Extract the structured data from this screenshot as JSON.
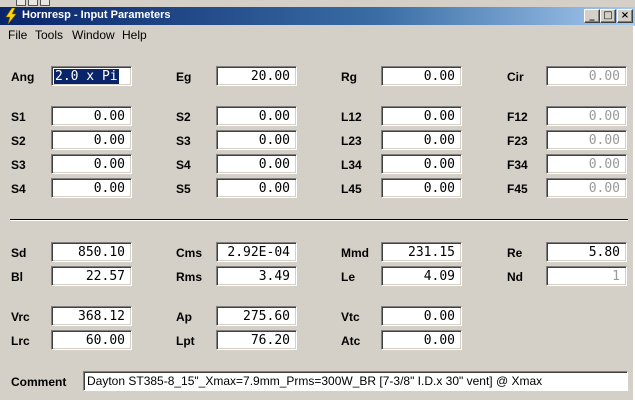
{
  "window": {
    "title": "Hornresp - Input Parameters",
    "controls": {
      "minimize": "_",
      "maximize": "□",
      "close": "×"
    }
  },
  "menu": [
    "File",
    "Tools",
    "Window",
    "Help"
  ],
  "fields": {
    "Ang": {
      "label": "Ang",
      "value": "2.0 x Pi"
    },
    "Eg": {
      "label": "Eg",
      "value": "20.00"
    },
    "Rg": {
      "label": "Rg",
      "value": "0.00"
    },
    "Cir": {
      "label": "Cir",
      "value": "0.00"
    },
    "S1_a": {
      "label": "S1",
      "value": "0.00"
    },
    "S2_a": {
      "label": "S2",
      "value": "0.00"
    },
    "S3_a": {
      "label": "S3",
      "value": "0.00"
    },
    "S4_a": {
      "label": "S4",
      "value": "0.00"
    },
    "S2_b": {
      "label": "S2",
      "value": "0.00"
    },
    "S3_b": {
      "label": "S3",
      "value": "0.00"
    },
    "S4_b": {
      "label": "S4",
      "value": "0.00"
    },
    "S5_b": {
      "label": "S5",
      "value": "0.00"
    },
    "L12": {
      "label": "L12",
      "value": "0.00"
    },
    "L23": {
      "label": "L23",
      "value": "0.00"
    },
    "L34": {
      "label": "L34",
      "value": "0.00"
    },
    "L45": {
      "label": "L45",
      "value": "0.00"
    },
    "F12": {
      "label": "F12",
      "value": "0.00"
    },
    "F23": {
      "label": "F23",
      "value": "0.00"
    },
    "F34": {
      "label": "F34",
      "value": "0.00"
    },
    "F45": {
      "label": "F45",
      "value": "0.00"
    },
    "Sd": {
      "label": "Sd",
      "value": "850.10"
    },
    "Cms": {
      "label": "Cms",
      "value": "2.92E-04"
    },
    "Mmd": {
      "label": "Mmd",
      "value": "231.15"
    },
    "Re": {
      "label": "Re",
      "value": "5.80"
    },
    "Bl": {
      "label": "Bl",
      "value": "22.57"
    },
    "Rms": {
      "label": "Rms",
      "value": "3.49"
    },
    "Le": {
      "label": "Le",
      "value": "4.09"
    },
    "Nd": {
      "label": "Nd",
      "value": "1"
    },
    "Vrc": {
      "label": "Vrc",
      "value": "368.12"
    },
    "Ap": {
      "label": "Ap",
      "value": "275.60"
    },
    "Vtc": {
      "label": "Vtc",
      "value": "0.00"
    },
    "Lrc": {
      "label": "Lrc",
      "value": "60.00"
    },
    "Lpt": {
      "label": "Lpt",
      "value": "76.20"
    },
    "Atc": {
      "label": "Atc",
      "value": "0.00"
    }
  },
  "comment": {
    "label": "Comment",
    "value": "Dayton ST385-8_15\"_Xmax=7.9mm_Prms=300W_BR [7-3/8\" I.D.x 30\" vent] @ Xmax"
  },
  "colors": {
    "title_start": "#0a246a",
    "title_end": "#a6caf0",
    "selection": "#0a246a",
    "disabled_text": "#9a9a9a"
  }
}
